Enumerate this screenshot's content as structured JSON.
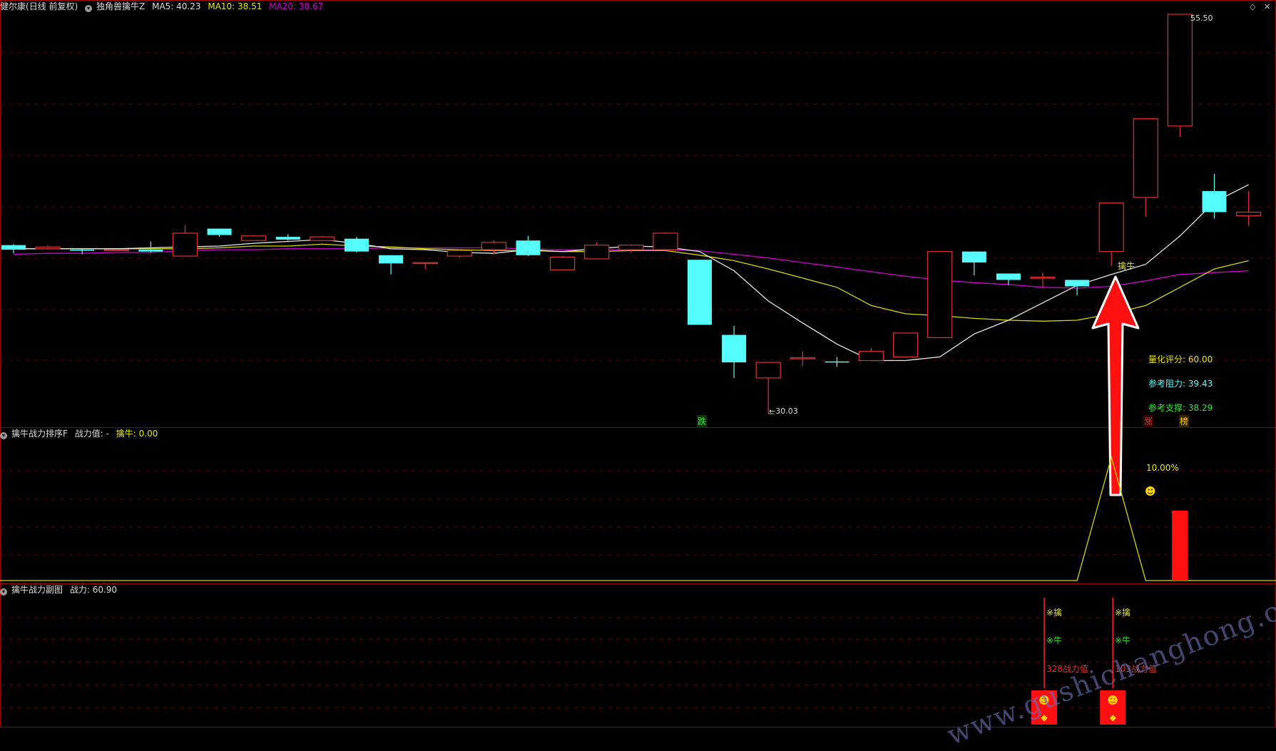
{
  "header": {
    "stock": "健尔康",
    "mode": "(日线 前复权)",
    "indicator": "独角兽擒牛Z",
    "ma5": "MA5: 40.23",
    "ma10": "MA10: 38.51",
    "ma20": "MA20: 38.67"
  },
  "sub1_header": {
    "name": "擒牛战力排序F",
    "power": "战力值: -",
    "qinniu": "擒牛: 0.00"
  },
  "sub2_header": {
    "name": "擒牛战力副图",
    "power": "战力: 60.90"
  },
  "info": {
    "score": "量化评分: 60.00",
    "resistance": "参考阻力: 39.43",
    "support": "参考支撑: 38.29"
  },
  "labels": {
    "qinniu": "擒牛",
    "high": "55.50",
    "low": "←30.03",
    "die": "跌",
    "zhang": "涨",
    "bang": "榜",
    "pct": "10.00%",
    "mark1": "※擒",
    "mark2": "※牛",
    "power1": "328战力值",
    "power2": "103战力值"
  },
  "watermark": "www.gushichanghong.com",
  "colors": {
    "up": "#e03030",
    "down": "#54fcfc",
    "ma5": "#e8e8e8",
    "ma10": "#d8d800",
    "ma20": "#d000d0",
    "grid": "#5a0000",
    "border": "#a00000"
  },
  "chart_data": [
    {
      "type": "candlestick",
      "title": "健尔康 (日线 前复权)",
      "categories": [
        "1",
        "2",
        "3",
        "4",
        "5",
        "6",
        "7",
        "8",
        "9",
        "10",
        "11",
        "12",
        "13",
        "14",
        "15",
        "16",
        "17",
        "18",
        "19",
        "20",
        "21",
        "22",
        "23",
        "24",
        "25",
        "26",
        "27",
        "28",
        "29",
        "30",
        "31",
        "32",
        "33",
        "34",
        "35",
        "36",
        "37"
      ],
      "candles": [
        {
          "o": 41.4,
          "c": 40.9,
          "h": 41.5,
          "l": 40.5
        },
        {
          "o": 41.0,
          "c": 41.2,
          "h": 41.4,
          "l": 40.9
        },
        {
          "o": 40.9,
          "c": 40.85,
          "h": 40.95,
          "l": 40.4
        },
        {
          "o": 40.8,
          "c": 40.9,
          "h": 40.95,
          "l": 40.75
        },
        {
          "o": 40.9,
          "c": 40.7,
          "h": 41.8,
          "l": 40.6
        },
        {
          "o": 40.2,
          "c": 42.7,
          "h": 43.6,
          "l": 40.2
        },
        {
          "o": 43.2,
          "c": 42.5,
          "h": 43.2,
          "l": 42.3
        },
        {
          "o": 41.9,
          "c": 42.4,
          "h": 42.5,
          "l": 41.9
        },
        {
          "o": 42.3,
          "c": 42.0,
          "h": 42.6,
          "l": 41.9
        },
        {
          "o": 41.9,
          "c": 42.3,
          "h": 42.4,
          "l": 41.8
        },
        {
          "o": 42.1,
          "c": 40.7,
          "h": 42.3,
          "l": 40.6
        },
        {
          "o": 40.3,
          "c": 39.4,
          "h": 40.3,
          "l": 38.2
        },
        {
          "o": 39.5,
          "c": 39.5,
          "h": 39.5,
          "l": 38.8
        },
        {
          "o": 40.2,
          "c": 40.8,
          "h": 40.9,
          "l": 40.0
        },
        {
          "o": 40.9,
          "c": 41.7,
          "h": 41.9,
          "l": 40.4
        },
        {
          "o": 41.9,
          "c": 40.3,
          "h": 42.4,
          "l": 40.2
        },
        {
          "o": 38.7,
          "c": 40.1,
          "h": 40.2,
          "l": 38.7
        },
        {
          "o": 39.9,
          "c": 41.4,
          "h": 41.7,
          "l": 39.9
        },
        {
          "o": 40.9,
          "c": 41.4,
          "h": 41.5,
          "l": 40.6
        },
        {
          "o": 40.9,
          "c": 42.7,
          "h": 42.8,
          "l": 40.9
        },
        {
          "o": 39.8,
          "c": 32.7,
          "h": 39.8,
          "l": 32.7
        },
        {
          "o": 31.6,
          "c": 28.6,
          "h": 32.6,
          "l": 26.9
        },
        {
          "o": 26.9,
          "c": 28.6,
          "h": 28.6,
          "l": 23.0
        },
        {
          "o": 29.0,
          "c": 29.1,
          "h": 29.8,
          "l": 28.2
        },
        {
          "o": 28.7,
          "c": 28.6,
          "h": 29.2,
          "l": 28.1
        },
        {
          "o": 28.8,
          "c": 29.8,
          "h": 30.2,
          "l": 28.8
        },
        {
          "o": 29.2,
          "c": 31.8,
          "h": 31.8,
          "l": 29.2
        },
        {
          "o": 31.3,
          "c": 40.7,
          "h": 40.7,
          "l": 31.3
        },
        {
          "o": 40.7,
          "c": 39.5,
          "h": 40.7,
          "l": 38.1
        },
        {
          "o": 38.3,
          "c": 37.6,
          "h": 38.3,
          "l": 37.0
        },
        {
          "o": 37.9,
          "c": 37.9,
          "h": 38.4,
          "l": 36.7
        },
        {
          "o": 37.6,
          "c": 36.9,
          "h": 37.6,
          "l": 35.9
        },
        {
          "o": 40.7,
          "c": 46.0,
          "h": 46.0,
          "l": 39.1
        },
        {
          "o": 46.6,
          "c": 55.2,
          "h": 55.2,
          "l": 44.5
        },
        {
          "o": 54.4,
          "c": 66.6,
          "h": 66.6,
          "l": 53.2
        },
        {
          "o": 47.3,
          "c": 45.0,
          "h": 49.2,
          "l": 44.3
        },
        {
          "o": 44.6,
          "c": 45.0,
          "h": 47.3,
          "l": 43.5
        }
      ],
      "ma5": [
        41.0,
        41.0,
        41.0,
        41.0,
        41.1,
        41.2,
        41.3,
        41.6,
        41.8,
        42.0,
        41.6,
        41.0,
        40.9,
        40.6,
        40.5,
        40.9,
        40.7,
        41.0,
        41.3,
        41.2,
        40.7,
        38.6,
        35.3,
        32.9,
        30.6,
        28.8,
        28.8,
        29.2,
        31.7,
        33.2,
        35.1,
        37.0,
        38.2,
        39.3,
        42.4,
        46.1,
        48.0
      ],
      "ma10": [
        41.0,
        41.0,
        41.0,
        41.0,
        41.0,
        41.0,
        41.1,
        41.3,
        41.3,
        41.5,
        41.3,
        41.2,
        41.0,
        40.9,
        40.8,
        40.8,
        40.7,
        40.7,
        40.8,
        40.8,
        40.3,
        39.7,
        38.8,
        37.8,
        36.8,
        34.8,
        33.9,
        33.7,
        33.4,
        33.2,
        33.1,
        33.2,
        33.9,
        34.8,
        36.8,
        38.8,
        39.7
      ],
      "ma20": [
        40.4,
        40.5,
        40.5,
        40.6,
        40.6,
        40.8,
        40.9,
        40.9,
        41.0,
        41.0,
        41.0,
        41.1,
        41.1,
        41.1,
        41.1,
        41.0,
        40.9,
        40.9,
        40.9,
        40.9,
        40.8,
        40.4,
        40.0,
        39.5,
        39.0,
        38.5,
        38.0,
        37.6,
        37.3,
        37.1,
        36.8,
        36.7,
        36.9,
        37.5,
        38.2,
        38.4,
        38.6
      ],
      "high_label": 55.5,
      "low_label": 30.03
    },
    {
      "type": "line",
      "title": "擒牛战力排序F",
      "series": [
        {
          "name": "擒牛",
          "values": [
            0,
            0,
            0,
            0,
            0,
            0,
            0,
            0,
            0,
            0,
            0,
            0,
            0,
            0,
            0,
            0,
            0,
            0,
            0,
            0,
            0,
            0,
            0,
            0,
            0,
            0,
            0,
            0,
            0,
            0,
            0,
            0,
            100,
            0,
            0,
            0,
            0
          ]
        }
      ],
      "bars": [
        {
          "index": 34,
          "value": 10.0
        }
      ],
      "pct_label": "10.00%"
    },
    {
      "type": "bar",
      "title": "擒牛战力副图",
      "signals": [
        {
          "index": 30,
          "power": 328
        },
        {
          "index": 32,
          "power": 103
        }
      ],
      "power": 60.9
    }
  ]
}
